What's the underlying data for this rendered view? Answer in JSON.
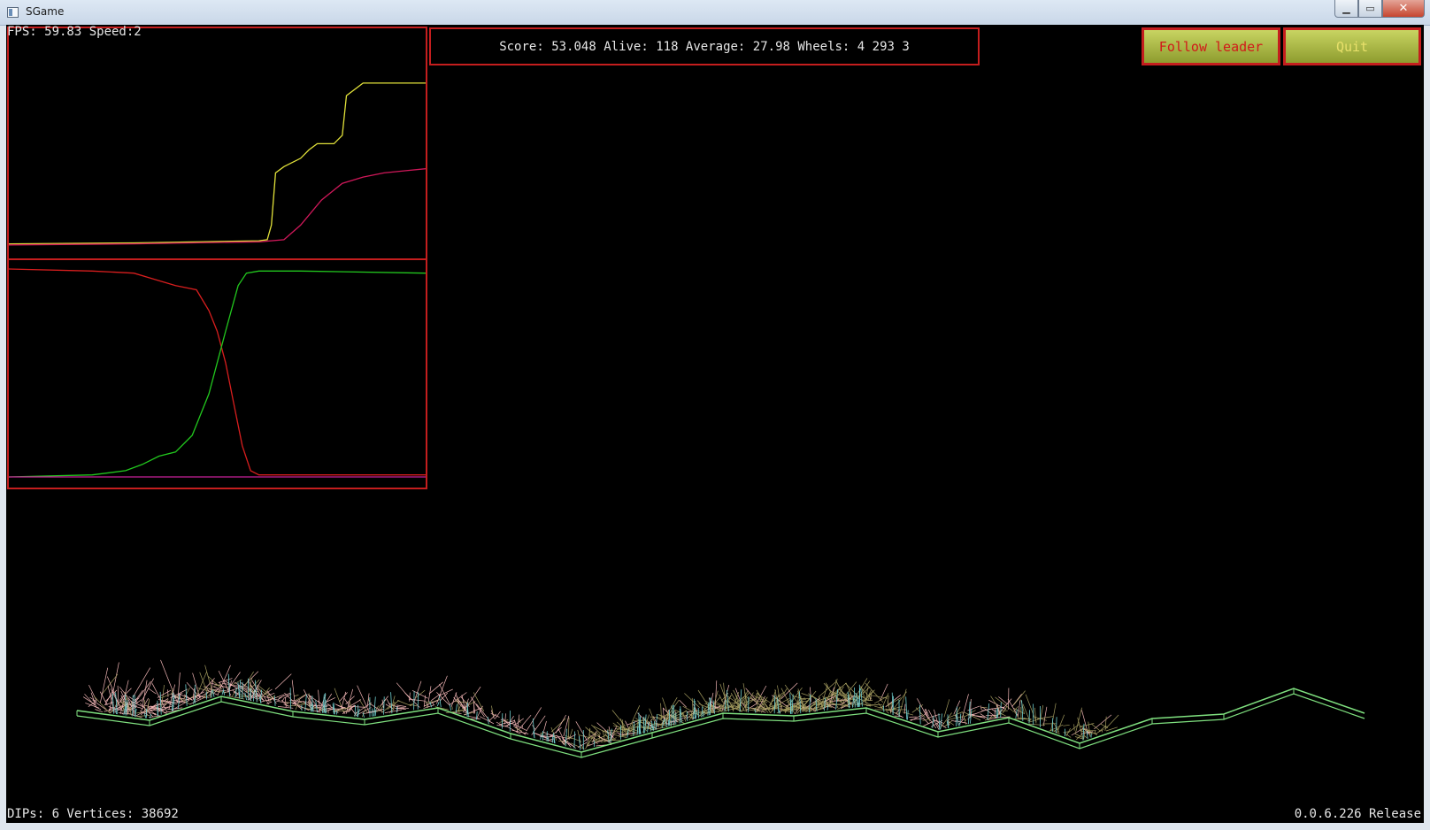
{
  "window": {
    "title": "SGame",
    "minimize_glyph": "▁",
    "maximize_glyph": "▭",
    "close_glyph": "✕"
  },
  "hud": {
    "fps_text": "FPS: 59.83 Speed:2",
    "score_text": "Score: 53.048 Alive: 118 Average: 27.98 Wheels: 4 293 3",
    "dips_text": "DIPs: 6 Vertices: 38692",
    "version_text": "0.0.6.226 Release"
  },
  "buttons": {
    "follow_leader": "Follow leader",
    "quit": "Quit"
  },
  "colors": {
    "panel_border": "#c41e1e",
    "best_score_line": "#e2e23a",
    "average_score_line": "#d0185a",
    "green_series": "#22c81e",
    "red_series": "#d81e1e",
    "magenta_series": "#c8209a",
    "terrain": "#7fe07f",
    "car_pink": "#f2b6b6",
    "car_olive": "#a29a5e",
    "car_cyan": "#6fd0d0"
  },
  "chart_data": [
    {
      "type": "line",
      "series": [
        {
          "color": "yellow",
          "x": [
            0,
            30,
            60,
            62,
            63,
            64,
            66,
            70,
            72,
            74,
            78,
            80,
            81,
            85,
            100
          ],
          "y": [
            1,
            1.5,
            2.5,
            3,
            10,
            35,
            38,
            42,
            46,
            49,
            49,
            53,
            72,
            78,
            78
          ]
        },
        {
          "color": "crimson",
          "x": [
            0,
            30,
            60,
            66,
            70,
            75,
            80,
            85,
            90,
            95,
            100
          ],
          "y": [
            0.5,
            1,
            2,
            3,
            10,
            22,
            30,
            33,
            35,
            36,
            37
          ]
        }
      ]
    },
    {
      "type": "line",
      "series": [
        {
          "color": "red",
          "x": [
            0,
            20,
            30,
            35,
            40,
            45,
            48,
            50,
            52,
            54,
            56,
            58,
            60,
            100
          ],
          "y": [
            100,
            99,
            98,
            95,
            92,
            90,
            80,
            70,
            55,
            35,
            15,
            3,
            1,
            1
          ]
        },
        {
          "color": "green",
          "x": [
            0,
            20,
            28,
            32,
            36,
            40,
            44,
            48,
            52,
            55,
            57,
            60,
            70,
            100
          ],
          "y": [
            0,
            1,
            3,
            6,
            10,
            12,
            20,
            40,
            70,
            92,
            98,
            99,
            99,
            98
          ]
        },
        {
          "color": "magenta",
          "x": [
            0,
            50,
            100
          ],
          "y": [
            0,
            0,
            0
          ]
        }
      ]
    }
  ]
}
